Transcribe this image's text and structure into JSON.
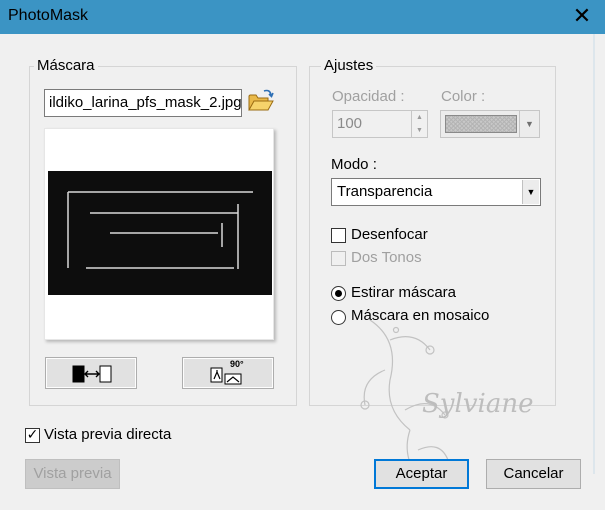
{
  "window": {
    "title": "PhotoMask",
    "close_glyph": "✕"
  },
  "mask_group": {
    "label": "Máscara",
    "filename": "ildiko_larina_pfs_mask_2.jpg",
    "open_icon": "folder-open-icon",
    "invert_icon": "invert-mask-icon",
    "rotate_icon": "rotate-90-icon",
    "rotate_badge": "90°"
  },
  "settings_group": {
    "label": "Ajustes",
    "opacity_label": "Opacidad :",
    "opacity_value": "100",
    "color_label": "Color :",
    "mode_label": "Modo :",
    "mode_value": "Transparencia",
    "blur_label": "Desenfocar",
    "blur_checked": false,
    "two_tones_label": "Dos Tonos",
    "two_tones_checked": false,
    "stretch_label": "Estirar máscara",
    "tile_label": "Máscara en mosaico",
    "selected_mode": "stretch"
  },
  "live_preview": {
    "label": "Vista previa directa",
    "checked": true
  },
  "buttons": {
    "preview": "Vista previa",
    "accept": "Aceptar",
    "cancel": "Cancelar"
  },
  "watermark": {
    "text": "Sylviane"
  },
  "colors": {
    "titlebar": "#3b94c4",
    "dialog": "#f0f0f0",
    "accent": "#0078d7"
  }
}
